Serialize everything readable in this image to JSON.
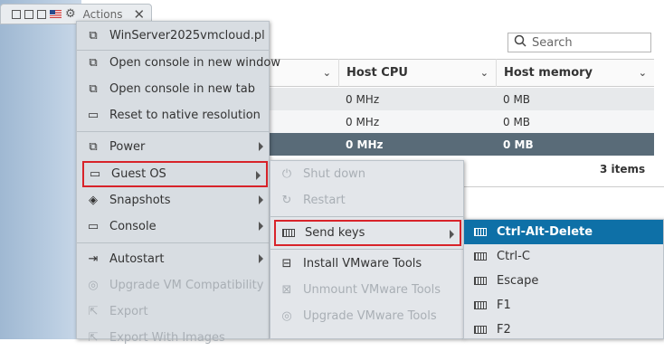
{
  "toolbar": {
    "actions_label": "Actions",
    "close_glyph": "✕"
  },
  "search": {
    "placeholder": "Search"
  },
  "table": {
    "columns": [
      "",
      "Host CPU",
      "Host memory"
    ],
    "rows": [
      {
        "cpu": "0 MHz",
        "mem": "0 MB",
        "selected": false
      },
      {
        "cpu": "0 MHz",
        "mem": "0 MB",
        "selected": false
      },
      {
        "cpu": "0 MHz",
        "mem": "0 MB",
        "selected": true
      }
    ],
    "count": "3 items"
  },
  "menu": {
    "title": "WinServer2025vmcloud.pl",
    "items": [
      {
        "label": "Open console in new window",
        "icon": "external-window-icon"
      },
      {
        "label": "Open console in new tab",
        "icon": "external-tab-icon"
      },
      {
        "label": "Reset to native resolution",
        "icon": "monitor-icon"
      },
      {
        "label": "Power",
        "icon": "power-vm-icon"
      },
      {
        "label": "Guest OS",
        "icon": "window-icon"
      },
      {
        "label": "Snapshots",
        "icon": "tag-icon"
      },
      {
        "label": "Console",
        "icon": "laptop-icon"
      },
      {
        "label": "Autostart",
        "icon": "autostart-icon"
      },
      {
        "label": "Upgrade VM Compatibility",
        "icon": "upgrade-icon"
      },
      {
        "label": "Export",
        "icon": "export-icon"
      },
      {
        "label": "Export With Images",
        "icon": "export-images-icon"
      }
    ]
  },
  "guest_menu": {
    "items": [
      {
        "label": "Shut down"
      },
      {
        "label": "Restart"
      },
      {
        "label": "Send keys"
      },
      {
        "label": "Install VMware Tools"
      },
      {
        "label": "Unmount VMware Tools"
      },
      {
        "label": "Upgrade VMware Tools"
      }
    ]
  },
  "keys_menu": {
    "items": [
      {
        "label": "Ctrl-Alt-Delete"
      },
      {
        "label": "Ctrl-C"
      },
      {
        "label": "Escape"
      },
      {
        "label": "F1"
      },
      {
        "label": "F2"
      }
    ]
  },
  "colors": {
    "highlight_border": "#d8232a",
    "active_item": "#0e70a7",
    "selected_row": "#596b78"
  }
}
